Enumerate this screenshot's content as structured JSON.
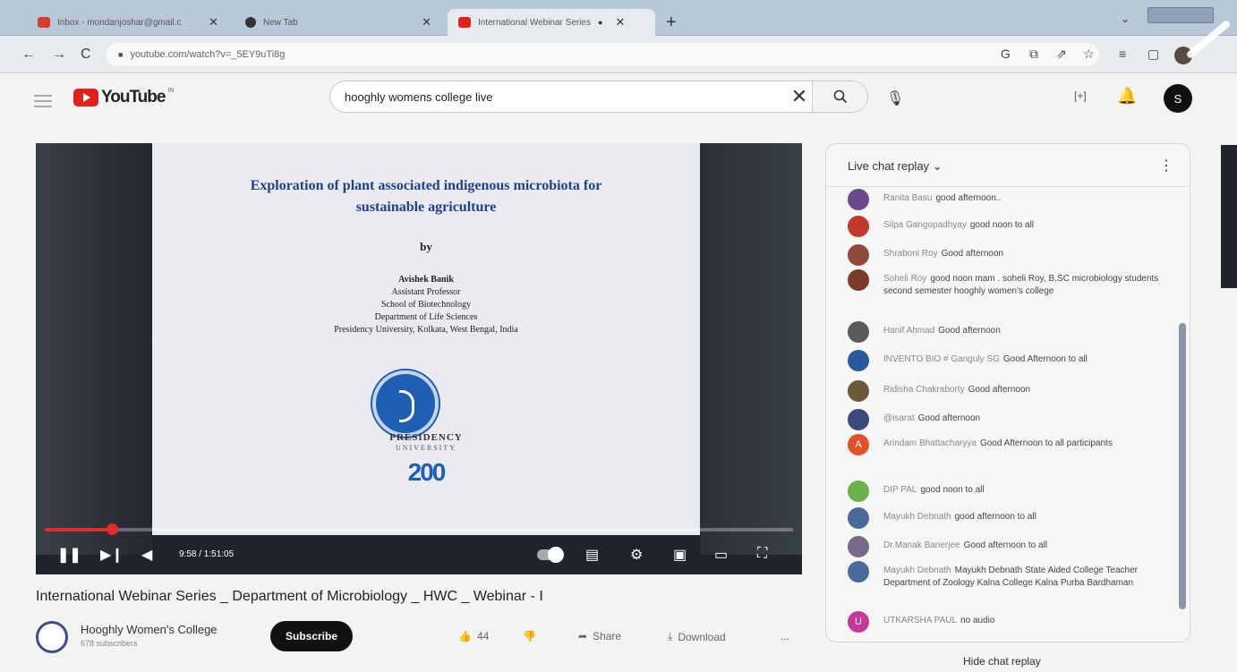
{
  "browser": {
    "tabs": [
      {
        "label": "Inbox - mondanjoshar@gmail.c",
        "favicon_color": "#d23f31",
        "active": false
      },
      {
        "label": "New Tab",
        "favicon_color": "#333333",
        "active": false
      },
      {
        "label": "International Webinar Series",
        "favicon_color": "#e1211b",
        "active": true
      }
    ],
    "url": "youtube.com/watch?v=_5EY9uTi8g"
  },
  "youtube": {
    "logo_text": "YouTube",
    "logo_sup": "IN",
    "search_value": "hooghly womens college live",
    "avatar_letter": "S"
  },
  "video": {
    "slide_title_1": "Exploration of plant associated indigenous microbiota for",
    "slide_title_2": "sustainable agriculture",
    "slide_by": "by",
    "slide_info": [
      "Avishek Banik",
      "Assistant Professor",
      "School of Biotechnology",
      "Department of Life Sciences",
      "Presidency University, Kolkata, West Bengal, India"
    ],
    "slide_university": "PRESIDENCY",
    "slide_university_2": "UNIVERSITY",
    "slide_number": "200",
    "time": "9:58 / 1:51:05",
    "progress_fraction": 0.09,
    "title": "International Webinar Series _ Department of Microbiology _ HWC _ Webinar - I"
  },
  "channel": {
    "name": "Hooghly Women's College",
    "subscribers": "678 subscribers",
    "subscribe_label": "Subscribe"
  },
  "actions": {
    "likes": "44",
    "share": "Share",
    "download": "Download",
    "more": "..."
  },
  "chat": {
    "title": "Live chat replay",
    "hide_label": "Hide chat replay",
    "messages": [
      {
        "author": "Ranita Basu",
        "text": "good afternoon..",
        "color": "#6a4a8a"
      },
      {
        "author": "Silpa Gangopadhyay",
        "text": "good noon to all",
        "color": "#c0392b"
      },
      {
        "author": "Shraboni Roy",
        "text": "Good afternoon",
        "color": "#8e4a3a"
      },
      {
        "author": "Soheli Roy",
        "text": "good noon mam . soheli Roy, B.SC microbiology students second semester hooghly women's college",
        "color": "#7a3a2a"
      },
      {
        "author": "Hanif Ahmad",
        "text": "Good afternoon",
        "color": "#5a5a5a"
      },
      {
        "author": "INVENTO BIO # Ganguly SG",
        "text": "Good Afternoon to all",
        "color": "#2a5a9a"
      },
      {
        "author": "Ridisha Chakraborty",
        "text": "Good afternoon",
        "color": "#6a5a3a"
      },
      {
        "author": "@isarat",
        "text": "Good afternoon",
        "color": "#3a4a7a"
      },
      {
        "author": "Arindam Bhattacharyya",
        "text": "Good Afternoon to all participants",
        "color": "#e0502a",
        "initial": "A"
      },
      {
        "author": "DIP PAL",
        "text": "good noon to all",
        "color": "#6ab04c"
      },
      {
        "author": "Mayukh Debnath",
        "text": "good afternoon to all",
        "color": "#4a6a9a"
      },
      {
        "author": "Dr.Manak Banerjee",
        "text": "Good afternoon to all",
        "color": "#7a6a8a"
      },
      {
        "author": "Mayukh Debnath",
        "text": "Mayukh Debnath State Aided College Teacher Department of Zoology Kalna College Kalna Purba Bardhaman",
        "color": "#4a6a9a"
      },
      {
        "author": "UTKARSHA PAUL",
        "text": "no audio",
        "color": "#c2399a",
        "initial": "U"
      }
    ]
  }
}
